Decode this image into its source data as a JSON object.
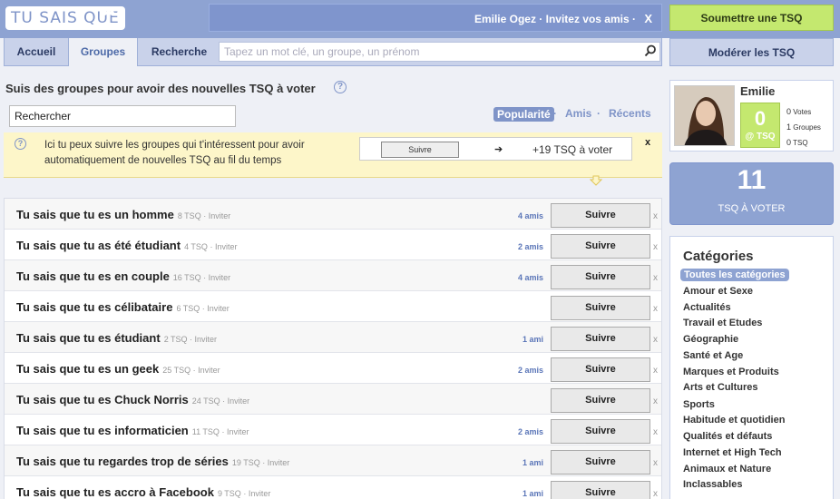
{
  "header": {
    "logo": "TU SAIS QUE",
    "user_text": "Emilie Ogez · Invitez vos amis ·",
    "close": "X",
    "submit_label": "Soumettre une TSQ"
  },
  "nav": {
    "tabs": [
      {
        "label": "Accueil"
      },
      {
        "label": "Groupes"
      },
      {
        "label": "Recherche"
      }
    ],
    "search_placeholder": "Tapez un mot clé, un groupe, un prénom",
    "moderate_label": "Modérer les TSQ"
  },
  "main": {
    "title": "Suis des groupes pour avoir des nouvelles TSQ à voter",
    "help": "?",
    "search_value": "Rechercher",
    "sort": {
      "popularity": "Popularité",
      "sep": "·",
      "friends": "Amis",
      "recent": "Récents"
    },
    "info": {
      "icon": "?",
      "text": "Ici tu peux suivre les groupes qui t'intéressent pour avoir automatiquement de nouvelles TSQ au fil du temps",
      "demo_button": "Suivre",
      "demo_arrow": "➔",
      "demo_result": "+19 TSQ à voter",
      "close": "x"
    },
    "groups": [
      {
        "title": "Tu sais que tu es un homme",
        "count": "8 TSQ",
        "invite": "Inviter",
        "friends": "4 amis",
        "button": "Suivre",
        "x": "x"
      },
      {
        "title": "Tu sais que tu as été étudiant",
        "count": "4 TSQ",
        "invite": "Inviter",
        "friends": "2 amis",
        "button": "Suivre",
        "x": "x"
      },
      {
        "title": "Tu sais que tu es en couple",
        "count": "16 TSQ",
        "invite": "Inviter",
        "friends": "4 amis",
        "button": "Suivre",
        "x": "x"
      },
      {
        "title": "Tu sais que tu es célibataire",
        "count": "6 TSQ",
        "invite": "Inviter",
        "friends": "",
        "button": "Suivre",
        "x": "x"
      },
      {
        "title": "Tu sais que tu es étudiant",
        "count": "2 TSQ",
        "invite": "Inviter",
        "friends": "1 ami",
        "button": "Suivre",
        "x": "x"
      },
      {
        "title": "Tu sais que tu es un geek",
        "count": "25 TSQ",
        "invite": "Inviter",
        "friends": "2 amis",
        "button": "Suivre",
        "x": "x"
      },
      {
        "title": "Tu sais que tu es Chuck Norris",
        "count": "24 TSQ",
        "invite": "Inviter",
        "friends": "",
        "button": "Suivre",
        "x": "x"
      },
      {
        "title": "Tu sais que tu es informaticien",
        "count": "11 TSQ",
        "invite": "Inviter",
        "friends": "2 amis",
        "button": "Suivre",
        "x": "x"
      },
      {
        "title": "Tu sais que tu regardes trop de séries",
        "count": "19 TSQ",
        "invite": "Inviter",
        "friends": "1 ami",
        "button": "Suivre",
        "x": "x"
      },
      {
        "title": "Tu sais que tu es accro à Facebook",
        "count": "9 TSQ",
        "invite": "Inviter",
        "friends": "1 ami",
        "button": "Suivre",
        "x": "x"
      }
    ]
  },
  "sidebar": {
    "profile": {
      "name": "Emilie",
      "score": "0",
      "score_label": "@ TSQ",
      "stats": [
        {
          "value": "0",
          "label": "Votes"
        },
        {
          "value": "1",
          "label": "Groupes"
        },
        {
          "value": "0",
          "label": "TSQ"
        }
      ]
    },
    "to_vote": {
      "count": "11",
      "label": "TSQ À VOTER"
    },
    "categories": {
      "title": "Catégories",
      "items": [
        "Toutes les catégories",
        "Amour et Sexe",
        "Actualités",
        "Travail et Etudes",
        "Géographie",
        "Santé et Age",
        "Marques et Produits",
        "Arts et Cultures",
        "Sports",
        "Habitude et quotidien",
        "Qualités et défauts",
        "Internet et High Tech",
        "Animaux et Nature",
        "Inclassables"
      ]
    }
  },
  "colors": {
    "brand_blue": "#8ea3d2",
    "accent_green": "#c4e86f",
    "info_yellow": "#fdf6c9"
  }
}
